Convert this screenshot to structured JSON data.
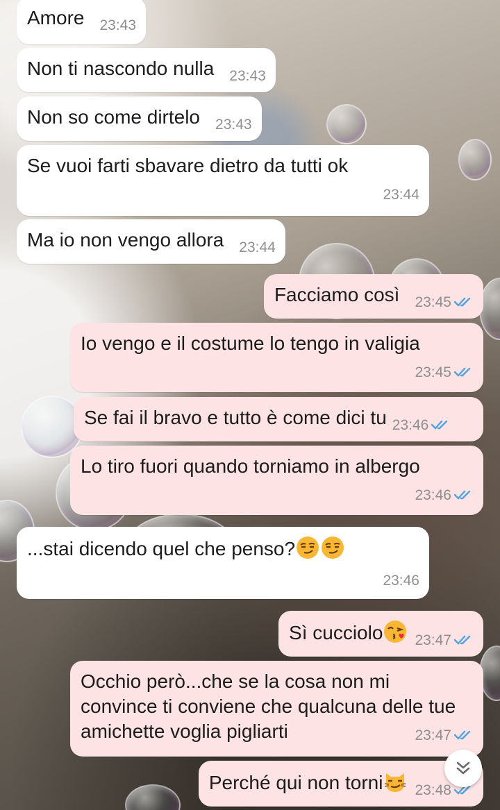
{
  "messages": [
    {
      "dir": "in",
      "text": "Amore",
      "time": "23:43"
    },
    {
      "dir": "in",
      "text": "Non ti nascondo nulla",
      "time": "23:43"
    },
    {
      "dir": "in",
      "text": "Non so come dirtelo",
      "time": "23:43"
    },
    {
      "dir": "in",
      "text": "Se vuoi farti sbavare dietro da tutti ok",
      "time": "23:44"
    },
    {
      "dir": "in",
      "text": "Ma io non vengo allora",
      "time": "23:44"
    },
    {
      "dir": "out",
      "text": "Facciamo così",
      "time": "23:45",
      "status": "read"
    },
    {
      "dir": "out",
      "text": "Io vengo e il costume lo tengo in valigia",
      "time": "23:45",
      "status": "read"
    },
    {
      "dir": "out",
      "text": "Se fai il bravo e tutto è come dici tu",
      "time": "23:46",
      "status": "read"
    },
    {
      "dir": "out",
      "text": "Lo tiro fuori quando torniamo in albergo",
      "time": "23:46",
      "status": "read"
    },
    {
      "dir": "in",
      "text": "...stai dicendo quel che penso?",
      "emoji": [
        "smirk",
        "smirk"
      ],
      "time": "23:46"
    },
    {
      "dir": "out",
      "text": "Sì cucciolo",
      "emoji": [
        "kiss"
      ],
      "time": "23:47",
      "status": "read"
    },
    {
      "dir": "out",
      "text": "Occhio però...che se la cosa non mi convince ti conviene che qualcuna delle tue amichette voglia pigliarti",
      "time": "23:47",
      "status": "read"
    },
    {
      "dir": "out",
      "text": "Perché qui non torni",
      "emoji": [
        "smirk-cat"
      ],
      "time": "23:48",
      "status": "read"
    }
  ],
  "icons": {
    "read_ticks": "double-check-icon",
    "scroll_down": "chevrons-down-icon"
  },
  "colors": {
    "incoming_bubble": "#ffffff",
    "outgoing_bubble": "#fde3e3",
    "read_tick": "#4fa3e0",
    "timestamp": "#8f8f8f"
  }
}
